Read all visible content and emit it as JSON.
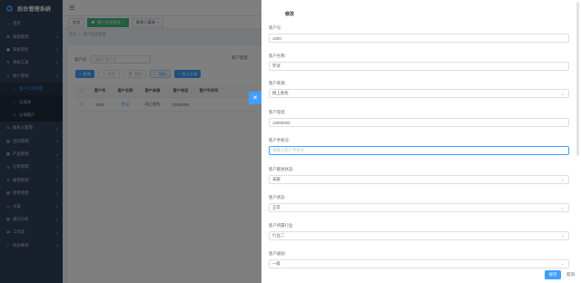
{
  "app": {
    "title": "后台管理系统"
  },
  "sidebar": {
    "items": [
      {
        "label": "首页",
        "icon": "home-icon"
      },
      {
        "label": "系统管理",
        "icon": "gear-icon"
      },
      {
        "label": "系统监控",
        "icon": "monitor-icon"
      },
      {
        "label": "系统工具",
        "icon": "tool-icon"
      },
      {
        "label": "客户管理",
        "icon": "user-icon"
      },
      {
        "label": "客户信息管理",
        "icon": "user-icon",
        "sub": true,
        "active": true
      },
      {
        "label": "公海池",
        "icon": "pool-icon",
        "sub": true
      },
      {
        "label": "公海客户",
        "icon": "user-icon",
        "sub": true
      },
      {
        "label": "联系人管理",
        "icon": "contact-icon"
      },
      {
        "label": "合同管理",
        "icon": "document-icon"
      },
      {
        "label": "产品管理",
        "icon": "box-icon"
      },
      {
        "label": "订单管理",
        "icon": "order-icon"
      },
      {
        "label": "报销管理",
        "icon": "money-icon"
      },
      {
        "label": "项目管理",
        "icon": "project-icon"
      },
      {
        "label": "大屏",
        "icon": "screen-icon"
      },
      {
        "label": "统计分析",
        "icon": "chart-icon"
      },
      {
        "label": "工作流",
        "icon": "flow-icon"
      },
      {
        "label": "待办事项",
        "icon": "todo-icon"
      }
    ]
  },
  "tags": [
    {
      "label": "首页"
    },
    {
      "label": "客户信息管理",
      "active": true
    },
    {
      "label": "联系人管理"
    }
  ],
  "breadcrumb": {
    "home": "首页",
    "sep": "/",
    "current": "客户信息管理"
  },
  "search": {
    "label": "客户名:",
    "placeholder": "请输入客户名",
    "label2": "客户电话:"
  },
  "buttons": {
    "add": "新增",
    "edit": "修改",
    "delete": "删除",
    "export": "导出",
    "to_pool": "转入公海"
  },
  "table": {
    "headers": [
      "客户号",
      "客户名称",
      "客户来源",
      "客户电话",
      "客户手机号"
    ],
    "rows": [
      [
        "1000",
        "罗试",
        "网上查找",
        "10000000",
        ""
      ]
    ]
  },
  "drawer": {
    "title": "修改",
    "fields": [
      {
        "label": "客户号:",
        "value": "1000",
        "type": "text"
      },
      {
        "label": "客户名称:",
        "value": "罗试",
        "type": "text"
      },
      {
        "label": "客户来源:",
        "value": "网上查找",
        "type": "select"
      },
      {
        "label": "客户电话:",
        "value": "10000000",
        "type": "text"
      },
      {
        "label": "客户手机号:",
        "value": "请输入客户手机号",
        "type": "placeholder"
      },
      {
        "label": "客户跟进状态:",
        "value": "未跟",
        "type": "select"
      },
      {
        "label": "客户状态:",
        "value": "正常",
        "type": "select"
      },
      {
        "label": "客户所属行业:",
        "value": "行业二",
        "type": "select"
      },
      {
        "label": "客户级别:",
        "value": "一级",
        "type": "select"
      }
    ],
    "save_label": "保存",
    "cancel_label": "取消"
  },
  "colors": {
    "primary": "#409eff",
    "sidebar": "#304156",
    "tag_active": "#42b983"
  }
}
